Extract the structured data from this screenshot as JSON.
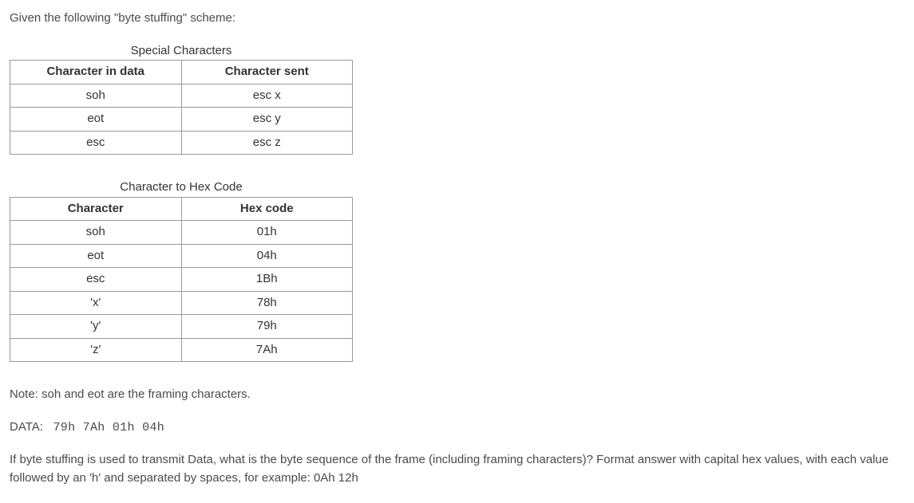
{
  "intro": "Given the following \"byte stuffing\" scheme:",
  "table1": {
    "caption": "Special Characters",
    "headers": [
      "Character in data",
      "Character sent"
    ],
    "rows": [
      [
        "soh",
        "esc x"
      ],
      [
        "eot",
        "esc y"
      ],
      [
        "esc",
        "esc z"
      ]
    ]
  },
  "table2": {
    "caption": "Character to Hex Code",
    "headers": [
      "Character",
      "Hex code"
    ],
    "rows": [
      [
        "soh",
        "01h"
      ],
      [
        "eot",
        "04h"
      ],
      [
        "esc",
        "1Bh"
      ],
      [
        "'x'",
        "78h"
      ],
      [
        "'y'",
        "79h"
      ],
      [
        "'z'",
        "7Ah"
      ]
    ]
  },
  "note": "Note: soh and eot are the framing characters.",
  "data_label": "DATA:",
  "data_value": "79h 7Ah 01h 04h",
  "question": "If byte stuffing is used to transmit Data, what is the byte sequence of the frame (including framing characters)? Format answer with capital hex values, with each value followed by an 'h' and separated by spaces, for example: 0Ah 12h"
}
